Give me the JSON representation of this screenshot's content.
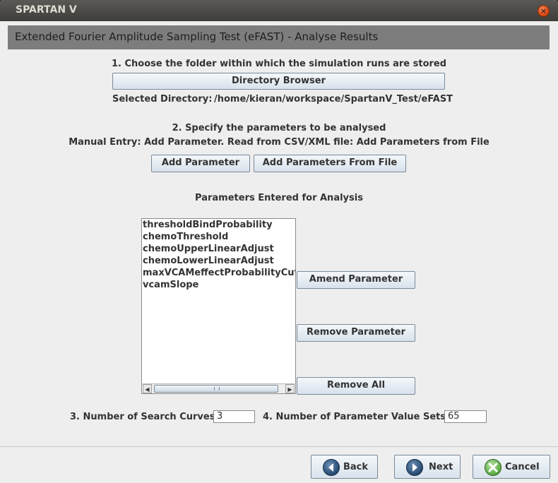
{
  "window": {
    "title": "SPARTAN V",
    "close_glyph": "×"
  },
  "header": {
    "title": "Extended Fourier Amplitude Sampling Test (eFAST) - Analyse Results"
  },
  "step1": {
    "label": "1. Choose the folder within which the simulation runs are stored",
    "browse_button": "Directory Browser",
    "selected_label": "Selected Directory:",
    "selected_path": "/home/kieran/workspace/SpartanV_Test/eFAST"
  },
  "step2": {
    "label": "2. Specify the parameters to be analysed",
    "hint": "Manual Entry: Add Parameter. Read from CSV/XML file: Add Parameters from File",
    "add_button": "Add Parameter",
    "add_from_file_button": "Add Parameters From File"
  },
  "parameters": {
    "heading": "Parameters Entered for Analysis",
    "items": [
      "thresholdBindProbability",
      "chemoThreshold",
      "chemoUpperLinearAdjust",
      "chemoLowerLinearAdjust",
      "maxVCAMeffectProbabilityCutoff",
      "vcamSlope"
    ],
    "amend_button": "Amend Parameter",
    "remove_button": "Remove Parameter",
    "remove_all_button": "Remove All"
  },
  "settings": {
    "curves_label": "3. Number of Search Curves:",
    "curves_value": "3",
    "value_sets_label": "4. Number of Parameter Value Sets:",
    "value_sets_value": "65"
  },
  "footer": {
    "back_label": "Back",
    "next_label": "Next",
    "cancel_label": "Cancel",
    "back_icon": "arrow-left-icon",
    "next_icon": "arrow-right-icon",
    "cancel_icon": "x-icon"
  },
  "scrollbar": {
    "left_arrow": "◀",
    "right_arrow": "▶"
  }
}
